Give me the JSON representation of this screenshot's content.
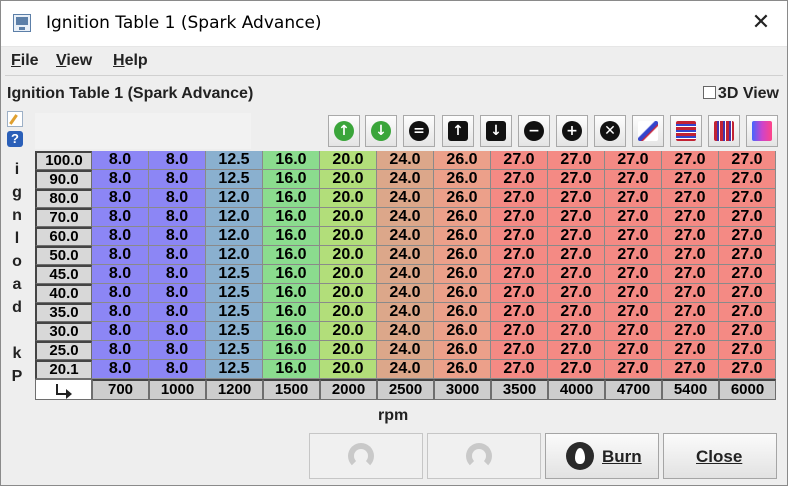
{
  "window": {
    "title": "Ignition Table 1 (Spark Advance)",
    "close_glyph": "✕"
  },
  "menu": {
    "file": "File",
    "view": "View",
    "help": "Help"
  },
  "panel": {
    "table_label": "Ignition Table 1 (Spark Advance)",
    "view3d_label": "3D View",
    "help_glyph": "?",
    "y_axis_letters": [
      "i",
      "g",
      "n",
      "l",
      "o",
      "a",
      "d",
      "k",
      "P"
    ],
    "x_axis_label": "rpm",
    "corner_icon": "swap-axes-icon"
  },
  "toolbar": {
    "buttons": [
      {
        "name": "increment-icon",
        "glyph": "↑",
        "color": "#3aa53a"
      },
      {
        "name": "decrement-icon",
        "glyph": "↓",
        "color": "#3aa53a"
      },
      {
        "name": "set-equal-icon",
        "glyph": "=",
        "color": "#111111"
      },
      {
        "name": "shift-up-icon",
        "glyph": "↑",
        "color": "#111111"
      },
      {
        "name": "shift-down-icon",
        "glyph": "↓",
        "color": "#111111"
      },
      {
        "name": "minus-icon",
        "glyph": "−",
        "color": "#111111"
      },
      {
        "name": "plus-icon",
        "glyph": "+",
        "color": "#111111"
      },
      {
        "name": "multiply-icon",
        "glyph": "✕",
        "color": "#111111"
      },
      {
        "name": "interpolate-icon",
        "glyph": "",
        "color": "#3344cc"
      },
      {
        "name": "horizontal-bars-icon",
        "glyph": "",
        "color": "#c22233"
      },
      {
        "name": "vertical-bars-icon",
        "glyph": "",
        "color": "#4433aa"
      },
      {
        "name": "gradient-icon",
        "glyph": "",
        "color": "#cc44cc"
      }
    ]
  },
  "table": {
    "load_bins": [
      "100.0",
      "90.0",
      "80.0",
      "70.0",
      "60.0",
      "50.0",
      "45.0",
      "40.0",
      "35.0",
      "30.0",
      "25.0",
      "20.1"
    ],
    "rpm_bins": [
      "700",
      "1000",
      "1200",
      "1500",
      "2000",
      "2500",
      "3000",
      "3500",
      "4000",
      "4700",
      "5400",
      "6000"
    ],
    "values": [
      [
        "8.0",
        "8.0",
        "12.5",
        "16.0",
        "20.0",
        "24.0",
        "26.0",
        "27.0",
        "27.0",
        "27.0",
        "27.0",
        "27.0"
      ],
      [
        "8.0",
        "8.0",
        "12.5",
        "16.0",
        "20.0",
        "24.0",
        "26.0",
        "27.0",
        "27.0",
        "27.0",
        "27.0",
        "27.0"
      ],
      [
        "8.0",
        "8.0",
        "12.0",
        "16.0",
        "20.0",
        "24.0",
        "26.0",
        "27.0",
        "27.0",
        "27.0",
        "27.0",
        "27.0"
      ],
      [
        "8.0",
        "8.0",
        "12.0",
        "16.0",
        "20.0",
        "24.0",
        "26.0",
        "27.0",
        "27.0",
        "27.0",
        "27.0",
        "27.0"
      ],
      [
        "8.0",
        "8.0",
        "12.0",
        "16.0",
        "20.0",
        "24.0",
        "26.0",
        "27.0",
        "27.0",
        "27.0",
        "27.0",
        "27.0"
      ],
      [
        "8.0",
        "8.0",
        "12.0",
        "16.0",
        "20.0",
        "24.0",
        "26.0",
        "27.0",
        "27.0",
        "27.0",
        "27.0",
        "27.0"
      ],
      [
        "8.0",
        "8.0",
        "12.5",
        "16.0",
        "20.0",
        "24.0",
        "26.0",
        "27.0",
        "27.0",
        "27.0",
        "27.0",
        "27.0"
      ],
      [
        "8.0",
        "8.0",
        "12.5",
        "16.0",
        "20.0",
        "24.0",
        "26.0",
        "27.0",
        "27.0",
        "27.0",
        "27.0",
        "27.0"
      ],
      [
        "8.0",
        "8.0",
        "12.5",
        "16.0",
        "20.0",
        "24.0",
        "26.0",
        "27.0",
        "27.0",
        "27.0",
        "27.0",
        "27.0"
      ],
      [
        "8.0",
        "8.0",
        "12.5",
        "16.0",
        "20.0",
        "24.0",
        "26.0",
        "27.0",
        "27.0",
        "27.0",
        "27.0",
        "27.0"
      ],
      [
        "8.0",
        "8.0",
        "12.5",
        "16.0",
        "20.0",
        "24.0",
        "26.0",
        "27.0",
        "27.0",
        "27.0",
        "27.0",
        "27.0"
      ],
      [
        "8.0",
        "8.0",
        "12.5",
        "16.0",
        "20.0",
        "24.0",
        "26.0",
        "27.0",
        "27.0",
        "27.0",
        "27.0",
        "27.0"
      ]
    ],
    "color_scale": {
      "8.0": "#8c86f5",
      "12.0": "#8ab0cf",
      "12.5": "#8ab0cf",
      "16.0": "#8bdc8e",
      "20.0": "#b2de7a",
      "24.0": "#dca78a",
      "26.0": "#eca08a",
      "27.0": "#f48a84"
    }
  },
  "buttons": {
    "undo_icon": "undo-icon",
    "redo_icon": "redo-icon",
    "burn": "Burn",
    "close": "Close"
  }
}
